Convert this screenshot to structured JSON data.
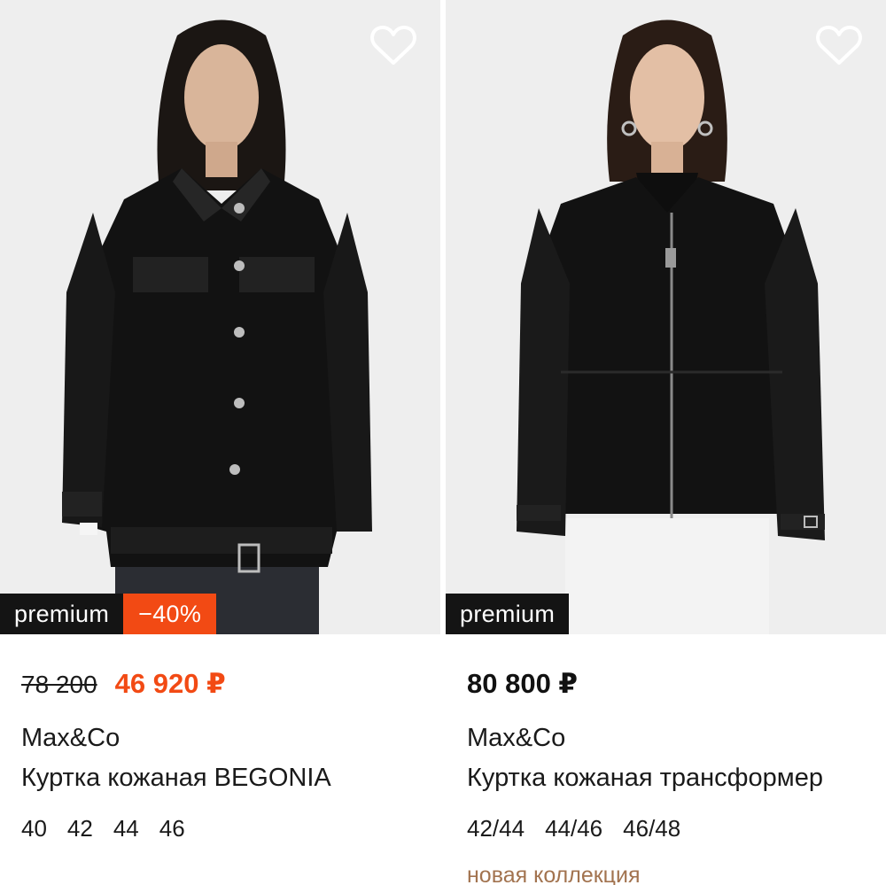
{
  "products": [
    {
      "badges": {
        "premium": "premium",
        "discount": "−40%"
      },
      "price_old": "78 200",
      "price_new": "46 920 ₽",
      "brand": "Max&Co",
      "title": "Куртка кожаная BEGONIA",
      "sizes": [
        "40",
        "42",
        "44",
        "46"
      ]
    },
    {
      "badges": {
        "premium": "premium"
      },
      "price": "80 800 ₽",
      "brand": "Max&Co",
      "title": "Куртка кожаная трансформер",
      "sizes": [
        "42/44",
        "44/46",
        "46/48"
      ],
      "tag": "новая коллекция"
    }
  ],
  "icons": {
    "favorite": "heart-outline-icon"
  },
  "colors": {
    "accent": "#f24a14",
    "badge_bg": "#141414",
    "tag": "#a2734f",
    "photo_bg": "#eeeeee"
  }
}
